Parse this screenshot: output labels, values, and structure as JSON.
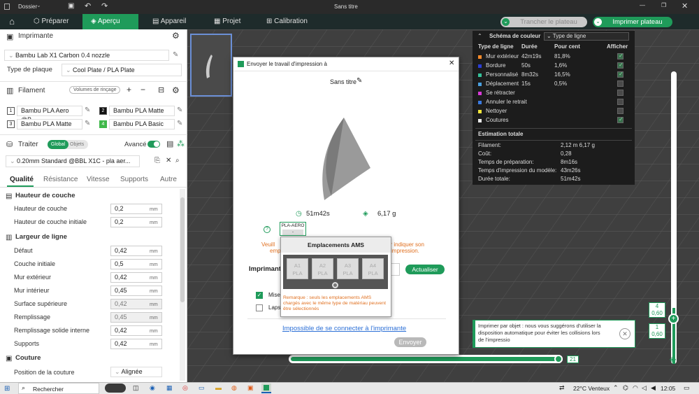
{
  "window": {
    "title": "Sans titre",
    "menu_label": "Dossier"
  },
  "topnav": {
    "tabs": [
      "Préparer",
      "Aperçu",
      "Appareil",
      "Projet",
      "Calibration"
    ],
    "slice_button": "Trancher le plateau",
    "print_button": "Imprimer plateau"
  },
  "left": {
    "printer_header": "Imprimante",
    "printer_name": "Bambu Lab X1 Carbon 0.4 nozzle",
    "plate_label": "Type de plaque",
    "plate_value": "Cool Plate / PLA Plate",
    "filament_header": "Filament",
    "rinse_label": "Volumes de rinçage",
    "filaments": [
      {
        "num": "1",
        "name": "Bambu PLA Aero @B...",
        "color": "#ffffff"
      },
      {
        "num": "2",
        "name": "Bambu PLA Matte",
        "color": "#111111"
      },
      {
        "num": "3",
        "name": "Bambu PLA Matte",
        "color": "#ffffff"
      },
      {
        "num": "4",
        "name": "Bambu PLA Basic",
        "color": "#3fb84a"
      }
    ],
    "process_header": "Traiter",
    "global_label": "Global",
    "objects_label": "Objets",
    "advanced_label": "Avancé",
    "process_profile": "0.20mm Standard @BBL X1C - pla aer...",
    "tabs": [
      "Qualité",
      "Résistance",
      "Vitesse",
      "Supports",
      "Autre"
    ],
    "groups": [
      {
        "title": "Hauteur de couche",
        "rows": [
          {
            "label": "Hauteur de couche",
            "value": "0,2",
            "unit": "mm",
            "disabled": false
          },
          {
            "label": "Hauteur de couche initiale",
            "value": "0,2",
            "unit": "mm",
            "disabled": false
          }
        ]
      },
      {
        "title": "Largeur de ligne",
        "rows": [
          {
            "label": "Défaut",
            "value": "0,42",
            "unit": "mm",
            "disabled": false
          },
          {
            "label": "Couche initiale",
            "value": "0,5",
            "unit": "mm",
            "disabled": false
          },
          {
            "label": "Mur extérieur",
            "value": "0,42",
            "unit": "mm",
            "disabled": false
          },
          {
            "label": "Mur intérieur",
            "value": "0,45",
            "unit": "mm",
            "disabled": false
          },
          {
            "label": "Surface supérieure",
            "value": "0,42",
            "unit": "mm",
            "disabled": true
          },
          {
            "label": "Remplissage",
            "value": "0,45",
            "unit": "mm",
            "disabled": true
          },
          {
            "label": "Remplissage solide interne",
            "value": "0,42",
            "unit": "mm",
            "disabled": false
          },
          {
            "label": "Supports",
            "value": "0,42",
            "unit": "mm",
            "disabled": false
          }
        ]
      },
      {
        "title": "Couture",
        "rows": [
          {
            "label": "Position de la couture",
            "value": "Alignée",
            "unit": "",
            "disabled": false
          }
        ]
      }
    ]
  },
  "legend": {
    "title": "Schéma de couleur",
    "dropdown": "Type de ligne",
    "columns": [
      "Type de ligne",
      "Durée",
      "Pour cent",
      "Afficher"
    ],
    "rows": [
      {
        "name": "Mur extérieur",
        "duration": "42m19s",
        "percent": "81,8%",
        "color": "#ff8c2a",
        "shown": true
      },
      {
        "name": "Bordure",
        "duration": "50s",
        "percent": "1,6%",
        "color": "#2a3dd6",
        "shown": true
      },
      {
        "name": "Personnalisé",
        "duration": "8m32s",
        "percent": "16,5%",
        "color": "#35c29a",
        "shown": true
      },
      {
        "name": "Déplacement",
        "duration": "15s",
        "percent": "0,5%",
        "color": "#4aa0e0",
        "shown": false
      },
      {
        "name": "Se rétracter",
        "duration": "",
        "percent": "",
        "color": "#d93ad9",
        "shown": false
      },
      {
        "name": "Annuler le retrait",
        "duration": "",
        "percent": "",
        "color": "#3a7ae0",
        "shown": false
      },
      {
        "name": "Nettoyer",
        "duration": "",
        "percent": "",
        "color": "#f2e63a",
        "shown": false
      },
      {
        "name": "Coutures",
        "duration": "",
        "percent": "",
        "color": "#e8e8e8",
        "shown": true
      }
    ],
    "estimate_title": "Estimation totale",
    "estimates": [
      {
        "k": "Filament:",
        "v": "2,12 m    6,17 g"
      },
      {
        "k": "Coût:",
        "v": "0,28"
      },
      {
        "k": "Temps de préparation:",
        "v": "8m16s"
      },
      {
        "k": "Temps d'impression du modèle:",
        "v": "43m26s"
      },
      {
        "k": "Durée totale:",
        "v": "51m42s"
      }
    ]
  },
  "dialog": {
    "title": "Envoyer le travail d'impression à",
    "project_name": "Sans titre",
    "time": "51m42s",
    "weight": "6,17 g",
    "filament_tag": "PLA-AERO",
    "warning_left": "Veuill",
    "warning_left2": "emp",
    "warning_right": "ur indiquer son",
    "warning_right2": "impression.",
    "printer_label": "Imprimant",
    "refresh_button": "Actualiser",
    "option1": "Mise",
    "option2": "Laps",
    "link": "Impossible de se connecter à l'imprimante",
    "send_button": "Envoyer",
    "ams": {
      "title": "Emplacements AMS",
      "slots": [
        {
          "id": "A1",
          "type": "PLA"
        },
        {
          "id": "A2",
          "type": "PLA"
        },
        {
          "id": "A3",
          "type": "PLA"
        },
        {
          "id": "A4",
          "type": "PLA"
        }
      ],
      "note": "Remarque : seuls les emplacements AMS chargés avec le même type de matériau peuvent être sélectionnés"
    }
  },
  "viewport": {
    "slider_value": "21",
    "layer_top_num": "4",
    "layer_top_val": "0,60",
    "layer_bot_num": "1",
    "layer_bot_val": "0,60",
    "toast": "Imprimer par objet : nous vous suggérons d'utiliser la disposition automatique pour éviter les collisions lors de l'impressio"
  },
  "taskbar": {
    "search": "Rechercher",
    "weather": "22°C  Venteux",
    "time": "12:05"
  }
}
